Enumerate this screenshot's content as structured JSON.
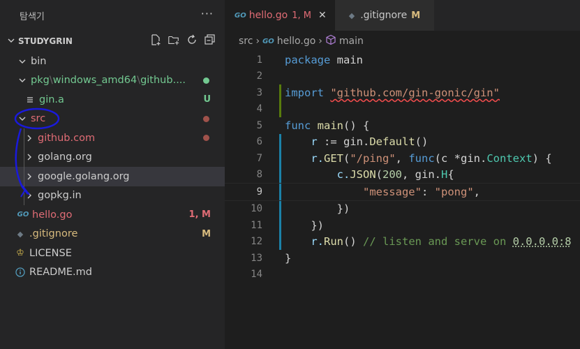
{
  "explorer": {
    "title": "탐색기",
    "more": "···",
    "project": "STUDYGRIN",
    "tree": [
      {
        "label": "bin",
        "indent": 0,
        "twisty": "open",
        "color": "#cccccc",
        "deco": ""
      },
      {
        "label": "pkg",
        "label2": "windows_amd64",
        "label3": "github....",
        "indent": 0,
        "twisty": "open",
        "color": "#73c991",
        "deco": "dot",
        "decoColor": "#73c991"
      },
      {
        "label": "gin.a",
        "indent": 1,
        "twisty": "",
        "icon": "lines-icon",
        "color": "#73c991",
        "deco": "U",
        "decoColor": "#73c991"
      },
      {
        "label": "src",
        "indent": 0,
        "twisty": "open",
        "color": "#e06c75",
        "deco": "dot",
        "decoColor": "#a0524b"
      },
      {
        "label": "github.com",
        "indent": 1,
        "twisty": "closed",
        "color": "#e06c75",
        "deco": "dot",
        "decoColor": "#a0524b"
      },
      {
        "label": "golang.org",
        "indent": 1,
        "twisty": "closed",
        "color": "#cccccc",
        "deco": ""
      },
      {
        "label": "google.golang.org",
        "indent": 1,
        "twisty": "closed",
        "color": "#cccccc",
        "deco": "",
        "selected": true
      },
      {
        "label": "gopkg.in",
        "indent": 1,
        "twisty": "closed",
        "color": "#cccccc",
        "deco": ""
      },
      {
        "label": "hello.go",
        "indent": 0,
        "twisty": "",
        "icon": "go-icon",
        "color": "#e06c75",
        "deco": "1, M",
        "decoColor": "#e06c75"
      },
      {
        "label": ".gitignore",
        "indent": -1,
        "twisty": "",
        "icon": "git-icon",
        "color": "#d7ba7d",
        "deco": "M",
        "decoColor": "#d7ba7d"
      },
      {
        "label": "LICENSE",
        "indent": -1,
        "twisty": "",
        "icon": "license-icon",
        "color": "#cccccc",
        "deco": ""
      },
      {
        "label": "README.md",
        "indent": -1,
        "twisty": "",
        "icon": "info-icon",
        "color": "#cccccc",
        "deco": ""
      }
    ]
  },
  "tabs": [
    {
      "icon": "GO",
      "label": "hello.go",
      "badge": "1, M",
      "active": true,
      "close": "✕"
    },
    {
      "icon": "◆",
      "label": ".gitignore",
      "badge": "M",
      "active": false
    }
  ],
  "breadcrumb": {
    "seg1": "src",
    "seg2": "hello.go",
    "seg3": "main",
    "sep": "›",
    "go": "GO"
  },
  "code": {
    "l1_kw": "package",
    "l1_id": " main",
    "l3_kw": "import",
    "l3_str": "\"github.com/gin-gonic/gin\"",
    "l5_kw": "func",
    "l5_fn": " main",
    "l5_p": "() {",
    "l6_a": "r",
    "l6_b": " := gin.",
    "l6_c": "Default",
    "l6_d": "()",
    "l7_a": "r.",
    "l7_b": "GET",
    "l7_c": "(",
    "l7_d": "\"/ping\"",
    "l7_e": ", ",
    "l7_f": "func",
    "l7_g": "(c *gin.",
    "l7_h": "Context",
    "l7_i": ") {",
    "l8_a": "c.",
    "l8_b": "JSON",
    "l8_c": "(",
    "l8_d": "200",
    "l8_e": ", gin.",
    "l8_f": "H",
    "l8_g": "{",
    "l9_a": "\"message\"",
    "l9_b": ": ",
    "l9_c": "\"pong\"",
    "l9_d": ",",
    "l10": "})",
    "l11": "})",
    "l12_a": "r.",
    "l12_b": "Run",
    "l12_c": "() ",
    "l12_d": "// listen and serve on ",
    "l12_e": "0.0.0.0:8",
    "l13": "}"
  },
  "line_numbers": [
    "1",
    "2",
    "3",
    "4",
    "5",
    "6",
    "7",
    "8",
    "9",
    "10",
    "11",
    "12",
    "13",
    "14"
  ]
}
